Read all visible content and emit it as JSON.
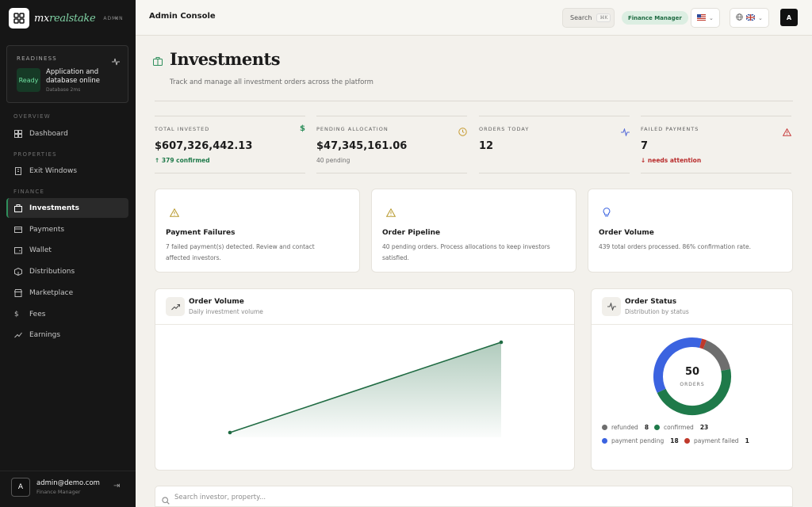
{
  "brand": {
    "name_main": "mx",
    "name_accent": "realstake",
    "badge": "ADMIN"
  },
  "readiness": {
    "title": "READINESS",
    "status": "Ready",
    "message": "Application and database online",
    "detail": "Database 2ms"
  },
  "nav": {
    "sections": [
      {
        "label": "OVERVIEW",
        "items": [
          {
            "label": "Dashboard",
            "icon": "dashboard-icon"
          }
        ]
      },
      {
        "label": "PROPERTIES",
        "items": [
          {
            "label": "Exit Windows",
            "icon": "building-icon"
          }
        ]
      },
      {
        "label": "FINANCE",
        "items": [
          {
            "label": "Investments",
            "icon": "briefcase-icon",
            "active": true
          },
          {
            "label": "Payments",
            "icon": "credit-card-icon"
          },
          {
            "label": "Wallet",
            "icon": "wallet-icon"
          },
          {
            "label": "Distributions",
            "icon": "package-icon"
          },
          {
            "label": "Marketplace",
            "icon": "store-icon"
          },
          {
            "label": "Fees",
            "icon": "dollar-icon"
          },
          {
            "label": "Earnings",
            "icon": "trending-up-icon"
          }
        ]
      }
    ]
  },
  "user": {
    "avatar": "A",
    "email": "admin@demo.com",
    "role": "Finance Manager"
  },
  "topbar": {
    "title": "Admin Console",
    "search_label": "Search",
    "search_kbd": "⌘K",
    "role_pill": "Finance Manager",
    "avatar": "A"
  },
  "page": {
    "title": "Investments",
    "subtitle": "Track and manage all investment orders across the platform"
  },
  "stats": [
    {
      "label": "TOTAL INVESTED",
      "value": "$607,326,442.13",
      "note": "↑ 379 confirmed",
      "tone": "green",
      "icon": "dollar-icon",
      "icon_color": "#2f8f5c"
    },
    {
      "label": "PENDING ALLOCATION",
      "value": "$47,345,161.06",
      "note": "40 pending",
      "tone": "muted",
      "icon": "clock-icon",
      "icon_color": "#c69a2e"
    },
    {
      "label": "ORDERS TODAY",
      "value": "12",
      "note": "",
      "tone": "muted",
      "icon": "activity-icon",
      "icon_color": "#5a6fd8"
    },
    {
      "label": "FAILED PAYMENTS",
      "value": "7",
      "note": "↓ needs attention",
      "tone": "red",
      "icon": "alert-triangle-icon",
      "icon_color": "#c73a3a"
    }
  ],
  "insights": [
    {
      "title": "Payment Failures",
      "text": "7 failed payment(s) detected. Review and contact affected investors.",
      "icon": "alert-triangle-icon"
    },
    {
      "title": "Order Pipeline",
      "text": "40 pending orders. Process allocations to keep investors satisfied.",
      "icon": "alert-triangle-icon"
    },
    {
      "title": "Order Volume",
      "text": "439 total orders processed. 86% confirmation rate.",
      "icon": "lightbulb-icon"
    }
  ],
  "volume_card": {
    "title": "Order Volume",
    "subtitle": "Daily investment volume"
  },
  "status_card": {
    "title": "Order Status",
    "subtitle": "Distribution by status",
    "center_value": "50",
    "center_label": "ORDERS"
  },
  "chart_data": [
    {
      "type": "area",
      "title": "Order Volume",
      "subtitle": "Daily investment volume",
      "x": [
        0,
        1
      ],
      "series": [
        {
          "values": [
            0,
            1
          ]
        }
      ],
      "color": "#1f6b42",
      "grid": false
    },
    {
      "type": "pie",
      "title": "Order Status",
      "subtitle": "Distribution by status",
      "categories": [
        "refunded",
        "confirmed",
        "payment pending",
        "payment failed"
      ],
      "values": [
        8,
        23,
        18,
        1
      ],
      "colors": [
        "#6e6e6e",
        "#1f7a4a",
        "#3b63e0",
        "#c0392b"
      ],
      "total": 50,
      "legend": "bottom"
    }
  ],
  "search": {
    "placeholder": "Search investor, property..."
  }
}
